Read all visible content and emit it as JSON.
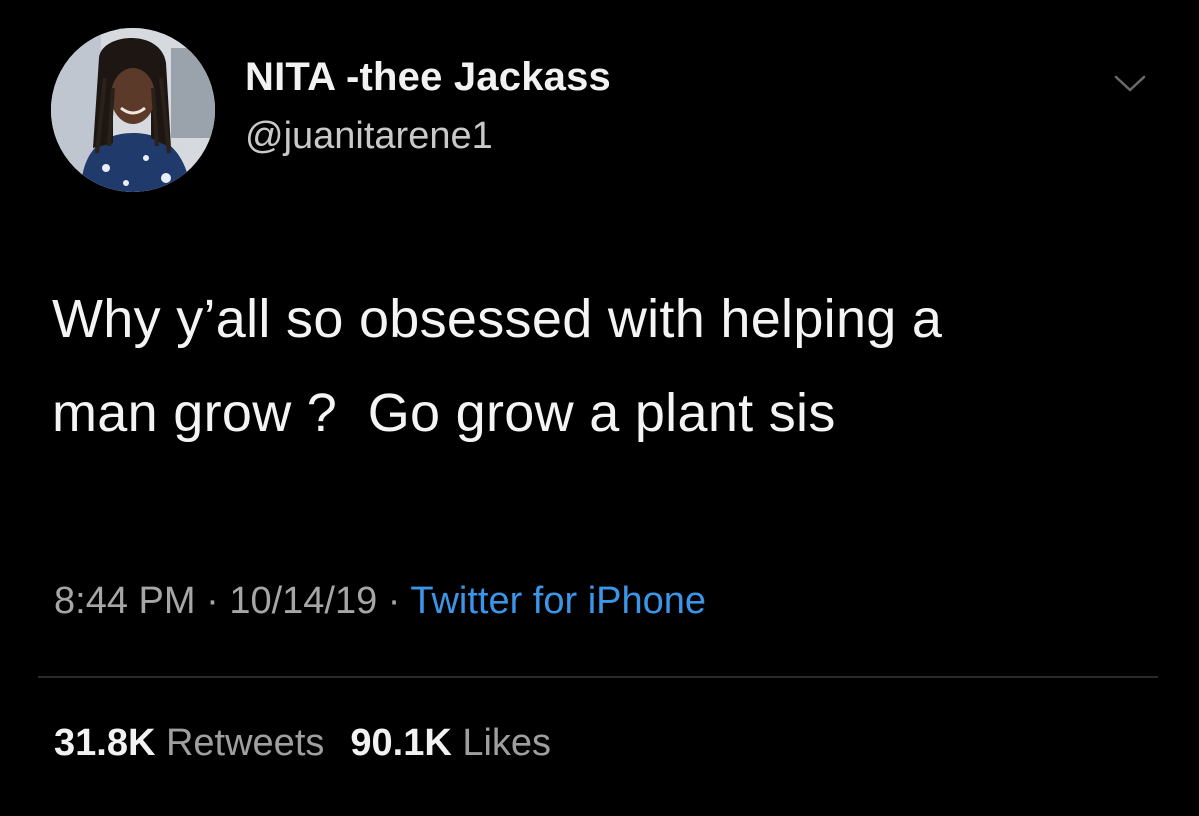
{
  "tweet": {
    "author": {
      "display_name": "NITA -thee Jackass",
      "handle": "@juanitarene1",
      "avatar_icon": "profile-photo"
    },
    "menu_icon": "chevron-down-icon",
    "text": "Why y’all so obsessed with helping a\nman grow ?  Go grow a plant sis",
    "time": "8:44 PM",
    "date": "10/14/19",
    "separator": " · ",
    "source": "Twitter for iPhone",
    "retweets_count": "31.8K",
    "retweets_label": "Retweets",
    "likes_count": "90.1K",
    "likes_label": "Likes"
  },
  "colors": {
    "background": "#000000",
    "source_link": "#3b95e8",
    "secondary_text": "#a6a6a6"
  }
}
